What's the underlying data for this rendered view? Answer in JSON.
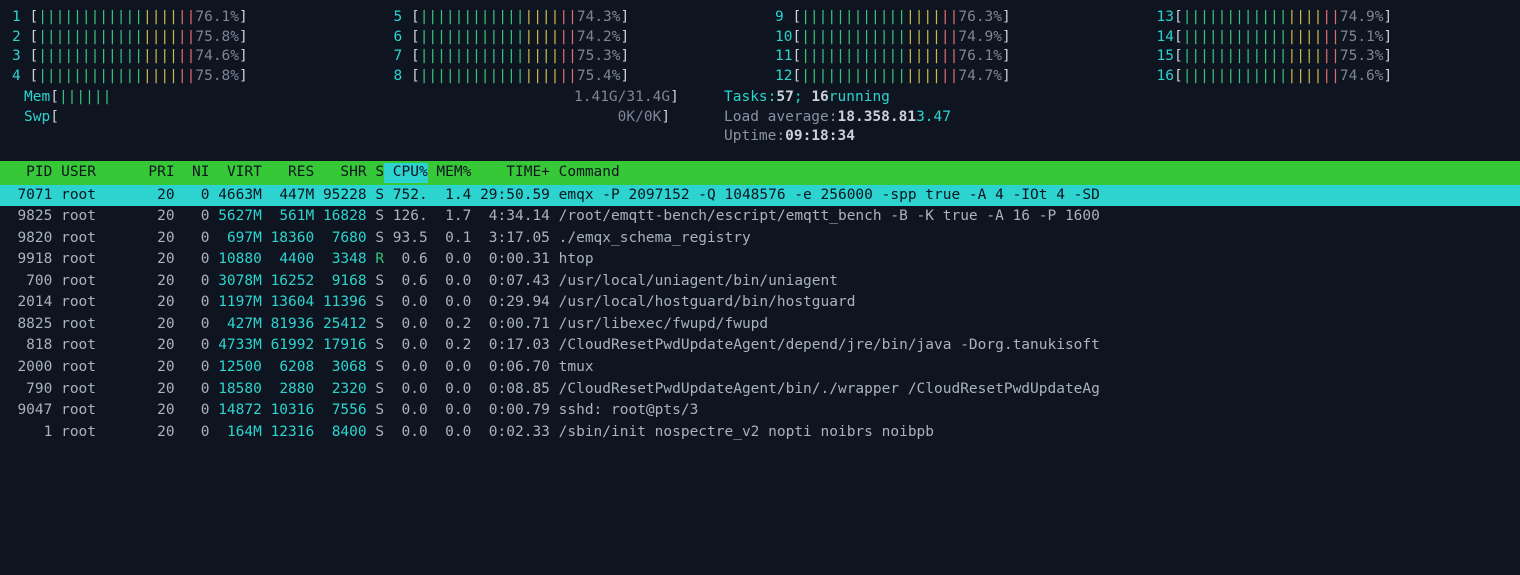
{
  "cpu_meters": [
    [
      {
        "id": "1",
        "pct": "76.1%"
      },
      {
        "id": "2",
        "pct": "75.8%"
      },
      {
        "id": "3",
        "pct": "74.6%"
      },
      {
        "id": "4",
        "pct": "75.8%"
      }
    ],
    [
      {
        "id": "5",
        "pct": "74.3%"
      },
      {
        "id": "6",
        "pct": "74.2%"
      },
      {
        "id": "7",
        "pct": "75.3%"
      },
      {
        "id": "8",
        "pct": "75.4%"
      }
    ],
    [
      {
        "id": "9",
        "pct": "76.3%"
      },
      {
        "id": "10",
        "pct": "74.9%"
      },
      {
        "id": "11",
        "pct": "76.1%"
      },
      {
        "id": "12",
        "pct": "74.7%"
      }
    ],
    [
      {
        "id": "13",
        "pct": "74.9%"
      },
      {
        "id": "14",
        "pct": "75.1%"
      },
      {
        "id": "15",
        "pct": "75.3%"
      },
      {
        "id": "16",
        "pct": "74.6%"
      }
    ]
  ],
  "mem": {
    "label": "Mem",
    "used": "1.41G",
    "total": "31.4G"
  },
  "swp": {
    "label": "Swp",
    "used": "0K",
    "total": "0K"
  },
  "tasks": {
    "label": "Tasks:",
    "total": "57",
    "running": "16",
    "running_label": "running"
  },
  "load": {
    "label": "Load average:",
    "v1": "18.35",
    "v2": "8.81",
    "v3": "3.47"
  },
  "uptime": {
    "label": "Uptime:",
    "value": "09:18:34"
  },
  "headers": {
    "pid": "PID",
    "user": "USER",
    "pri": "PRI",
    "ni": "NI",
    "virt": "VIRT",
    "res": "RES",
    "shr": "SHR",
    "s": "S",
    "cpu": "CPU%",
    "mem": "MEM%",
    "time": "TIME+",
    "cmd": "Command"
  },
  "processes": [
    {
      "pid": "7071",
      "user": "root",
      "pri": "20",
      "ni": "0",
      "virt": "4663M",
      "res": "447M",
      "shr": "95228",
      "s": "S",
      "cpu": "752.",
      "mem": "1.4",
      "time": "29:50.59",
      "cmd": "emqx -P 2097152 -Q 1048576 -e 256000 -spp true -A 4 -IOt 4 -SD",
      "sel": true
    },
    {
      "pid": "9825",
      "user": "root",
      "pri": "20",
      "ni": "0",
      "virt": "5627M",
      "res": "561M",
      "shr": "16828",
      "s": "S",
      "cpu": "126.",
      "mem": "1.7",
      "time": "4:34.14",
      "cmd": "/root/emqtt-bench/escript/emqtt_bench -B -K true -A 16 -P 1600"
    },
    {
      "pid": "9820",
      "user": "root",
      "pri": "20",
      "ni": "0",
      "virt": "697M",
      "res": "18360",
      "shr": "7680",
      "s": "S",
      "cpu": "93.5",
      "mem": "0.1",
      "time": "3:17.05",
      "cmd": "./emqx_schema_registry"
    },
    {
      "pid": "9918",
      "user": "root",
      "pri": "20",
      "ni": "0",
      "virt": "10880",
      "res": "4400",
      "shr": "3348",
      "s": "R",
      "cpu": "0.6",
      "mem": "0.0",
      "time": "0:00.31",
      "cmd": "htop"
    },
    {
      "pid": "700",
      "user": "root",
      "pri": "20",
      "ni": "0",
      "virt": "3078M",
      "res": "16252",
      "shr": "9168",
      "s": "S",
      "cpu": "0.6",
      "mem": "0.0",
      "time": "0:07.43",
      "cmd": "/usr/local/uniagent/bin/uniagent"
    },
    {
      "pid": "2014",
      "user": "root",
      "pri": "20",
      "ni": "0",
      "virt": "1197M",
      "res": "13604",
      "shr": "11396",
      "s": "S",
      "cpu": "0.0",
      "mem": "0.0",
      "time": "0:29.94",
      "cmd": "/usr/local/hostguard/bin/hostguard"
    },
    {
      "pid": "8825",
      "user": "root",
      "pri": "20",
      "ni": "0",
      "virt": "427M",
      "res": "81936",
      "shr": "25412",
      "s": "S",
      "cpu": "0.0",
      "mem": "0.2",
      "time": "0:00.71",
      "cmd": "/usr/libexec/fwupd/fwupd"
    },
    {
      "pid": "818",
      "user": "root",
      "pri": "20",
      "ni": "0",
      "virt": "4733M",
      "res": "61992",
      "shr": "17916",
      "s": "S",
      "cpu": "0.0",
      "mem": "0.2",
      "time": "0:17.03",
      "cmd": "/CloudResetPwdUpdateAgent/depend/jre/bin/java -Dorg.tanukisoft"
    },
    {
      "pid": "2000",
      "user": "root",
      "pri": "20",
      "ni": "0",
      "virt": "12500",
      "res": "6208",
      "shr": "3068",
      "s": "S",
      "cpu": "0.0",
      "mem": "0.0",
      "time": "0:06.70",
      "cmd": "tmux"
    },
    {
      "pid": "790",
      "user": "root",
      "pri": "20",
      "ni": "0",
      "virt": "18580",
      "res": "2880",
      "shr": "2320",
      "s": "S",
      "cpu": "0.0",
      "mem": "0.0",
      "time": "0:08.85",
      "cmd": "/CloudResetPwdUpdateAgent/bin/./wrapper /CloudResetPwdUpdateAg"
    },
    {
      "pid": "9047",
      "user": "root",
      "pri": "20",
      "ni": "0",
      "virt": "14872",
      "res": "10316",
      "shr": "7556",
      "s": "S",
      "cpu": "0.0",
      "mem": "0.0",
      "time": "0:00.79",
      "cmd": "sshd: root@pts/3"
    },
    {
      "pid": "1",
      "user": "root",
      "pri": "20",
      "ni": "0",
      "virt": "164M",
      "res": "12316",
      "shr": "8400",
      "s": "S",
      "cpu": "0.0",
      "mem": "0.0",
      "time": "0:02.33",
      "cmd": "/sbin/init nospectre_v2 nopti noibrs noibpb"
    }
  ]
}
